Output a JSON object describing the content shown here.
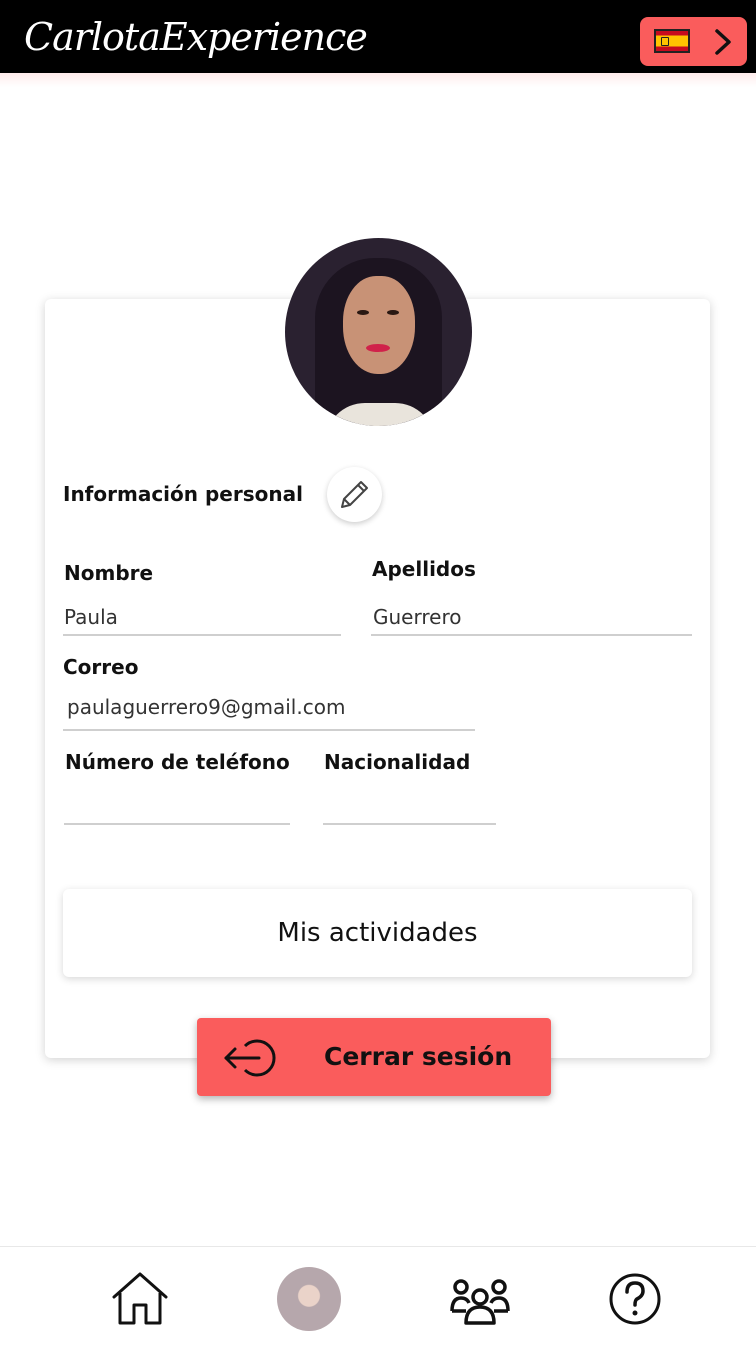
{
  "header": {
    "logo": "CarlotaExperience",
    "language_button": {
      "flag_icon": "spain-flag-icon",
      "arrow_icon": "chevron-right-icon"
    }
  },
  "profile": {
    "section_title": "Información personal",
    "fields": {
      "nombre": {
        "label": "Nombre",
        "value": "Paula"
      },
      "apellidos": {
        "label": "Apellidos",
        "value": "Guerrero"
      },
      "correo": {
        "label": "Correo",
        "value": "paulaguerrero9@gmail.com"
      },
      "telefono": {
        "label": "Número de teléfono",
        "value": ""
      },
      "nacionalidad": {
        "label": "Nacionalidad",
        "value": ""
      }
    },
    "activities_button": "Mis actividades",
    "logout_button": "Cerrar sesión"
  },
  "bottom_nav": {
    "items": [
      "home-icon",
      "profile-avatar",
      "group-icon",
      "help-icon"
    ]
  },
  "colors": {
    "accent": "#fa5c5c",
    "header_bg": "#000000"
  }
}
